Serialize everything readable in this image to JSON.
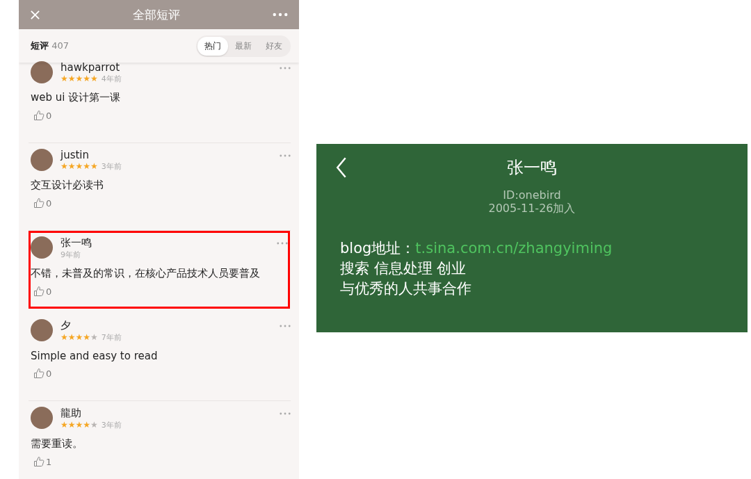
{
  "reviews_screen": {
    "title": "全部短评",
    "subheader": {
      "label": "短评",
      "count": "407"
    },
    "tabs": [
      {
        "label": "热门",
        "selected": true
      },
      {
        "label": "最新",
        "selected": false
      },
      {
        "label": "好友",
        "selected": false
      }
    ],
    "reviews": [
      {
        "user": "hawkparrot",
        "stars": 5,
        "time": "4年前",
        "text": "web ui 设计第一课",
        "likes": "0",
        "highlighted": false
      },
      {
        "user": "justin",
        "stars": 5,
        "time": "3年前",
        "text": "交互设计必读书",
        "likes": "0",
        "highlighted": false
      },
      {
        "user": "张一鸣",
        "time": "9年前",
        "text": "不错，未普及的常识，在核心产品技术人员要普及",
        "likes": "0",
        "highlighted": true
      },
      {
        "user": "夕",
        "stars": 4,
        "time": "7年前",
        "text": "Simple and easy to read",
        "likes": "0",
        "highlighted": false
      },
      {
        "user": "龍助",
        "stars": 4,
        "time": "3年前",
        "text": "需要重读。",
        "likes": "1",
        "highlighted": false
      }
    ]
  },
  "profile_screen": {
    "name": "张一鸣",
    "id": "ID:onebird",
    "joined": "2005-11-26加入",
    "blog_label": "blog地址：",
    "blog_link": "t.sina.com.cn/zhangyiming",
    "bio_lines": [
      "搜索 信息处理 创业",
      "与优秀的人共事合作"
    ]
  }
}
